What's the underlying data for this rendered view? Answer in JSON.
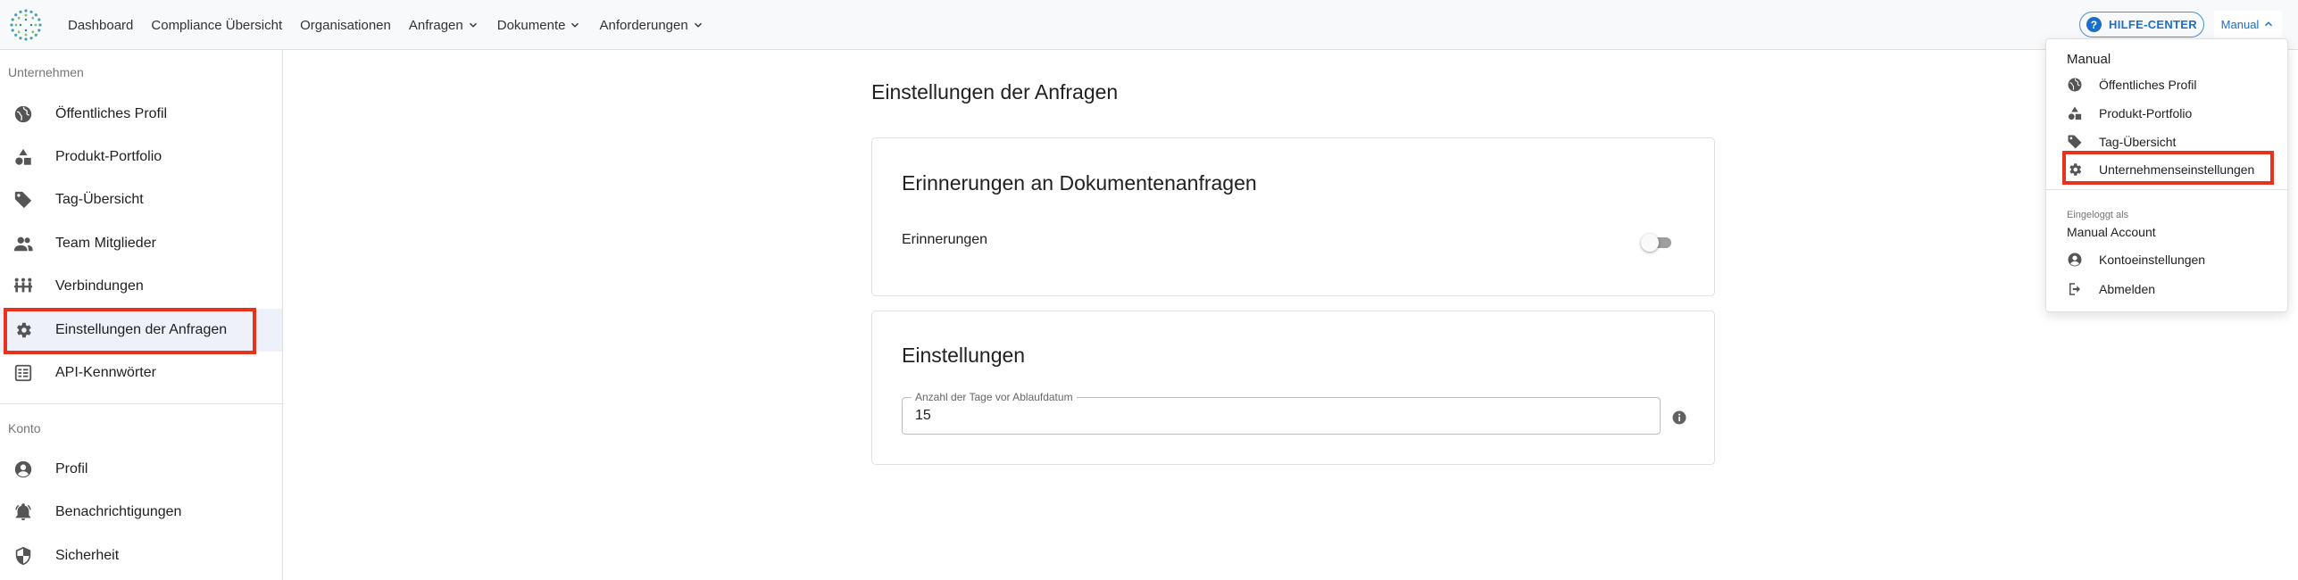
{
  "topbar": {
    "nav": [
      {
        "label": "Dashboard",
        "dropdown": false
      },
      {
        "label": "Compliance Übersicht",
        "dropdown": false
      },
      {
        "label": "Organisationen",
        "dropdown": false
      },
      {
        "label": "Anfragen",
        "dropdown": true
      },
      {
        "label": "Dokumente",
        "dropdown": true
      },
      {
        "label": "Anforderungen",
        "dropdown": true
      }
    ],
    "help_label": "HILFE-CENTER",
    "user_menu_label": "Manual"
  },
  "sidebar": {
    "company_section": "Unternehmen",
    "company_items": [
      {
        "label": "Öffentliches Profil",
        "icon": "globe-icon"
      },
      {
        "label": "Produkt-Portfolio",
        "icon": "shapes-icon"
      },
      {
        "label": "Tag-Übersicht",
        "icon": "tag-icon"
      },
      {
        "label": "Team Mitglieder",
        "icon": "people-icon"
      },
      {
        "label": "Verbindungen",
        "icon": "connections-icon"
      },
      {
        "label": "Einstellungen der Anfragen",
        "icon": "gear-icon",
        "active": true
      },
      {
        "label": "API-Kennwörter",
        "icon": "api-key-icon"
      }
    ],
    "account_section": "Konto",
    "account_items": [
      {
        "label": "Profil",
        "icon": "account-circle-icon"
      },
      {
        "label": "Benachrichtigungen",
        "icon": "bell-icon"
      },
      {
        "label": "Sicherheit",
        "icon": "shield-icon"
      }
    ]
  },
  "main": {
    "title": "Einstellungen der Anfragen",
    "reminders_card": {
      "title": "Erinnerungen an Dokumentenanfragen",
      "toggle_label": "Erinnerungen",
      "toggle_on": false
    },
    "settings_card": {
      "title": "Einstellungen",
      "field_label": "Anzahl der Tage vor Ablaufdatum",
      "field_value": "15"
    }
  },
  "user_menu": {
    "heading": "Manual",
    "items": [
      {
        "label": "Öffentliches Profil",
        "icon": "globe-icon"
      },
      {
        "label": "Produkt-Portfolio",
        "icon": "shapes-icon"
      },
      {
        "label": "Tag-Übersicht",
        "icon": "tag-icon"
      },
      {
        "label": "Unternehmenseinstellungen",
        "icon": "gear-icon",
        "highlighted": true
      }
    ],
    "logged_in_as": "Eingeloggt als",
    "account_name": "Manual Account",
    "account_items": [
      {
        "label": "Kontoeinstellungen",
        "icon": "account-circle-icon"
      },
      {
        "label": "Abmelden",
        "icon": "logout-icon"
      }
    ]
  },
  "colors": {
    "accent": "#1a6fc9",
    "highlight": "#e8321d",
    "active_bg": "#eef1f9",
    "icon": "#555555"
  }
}
